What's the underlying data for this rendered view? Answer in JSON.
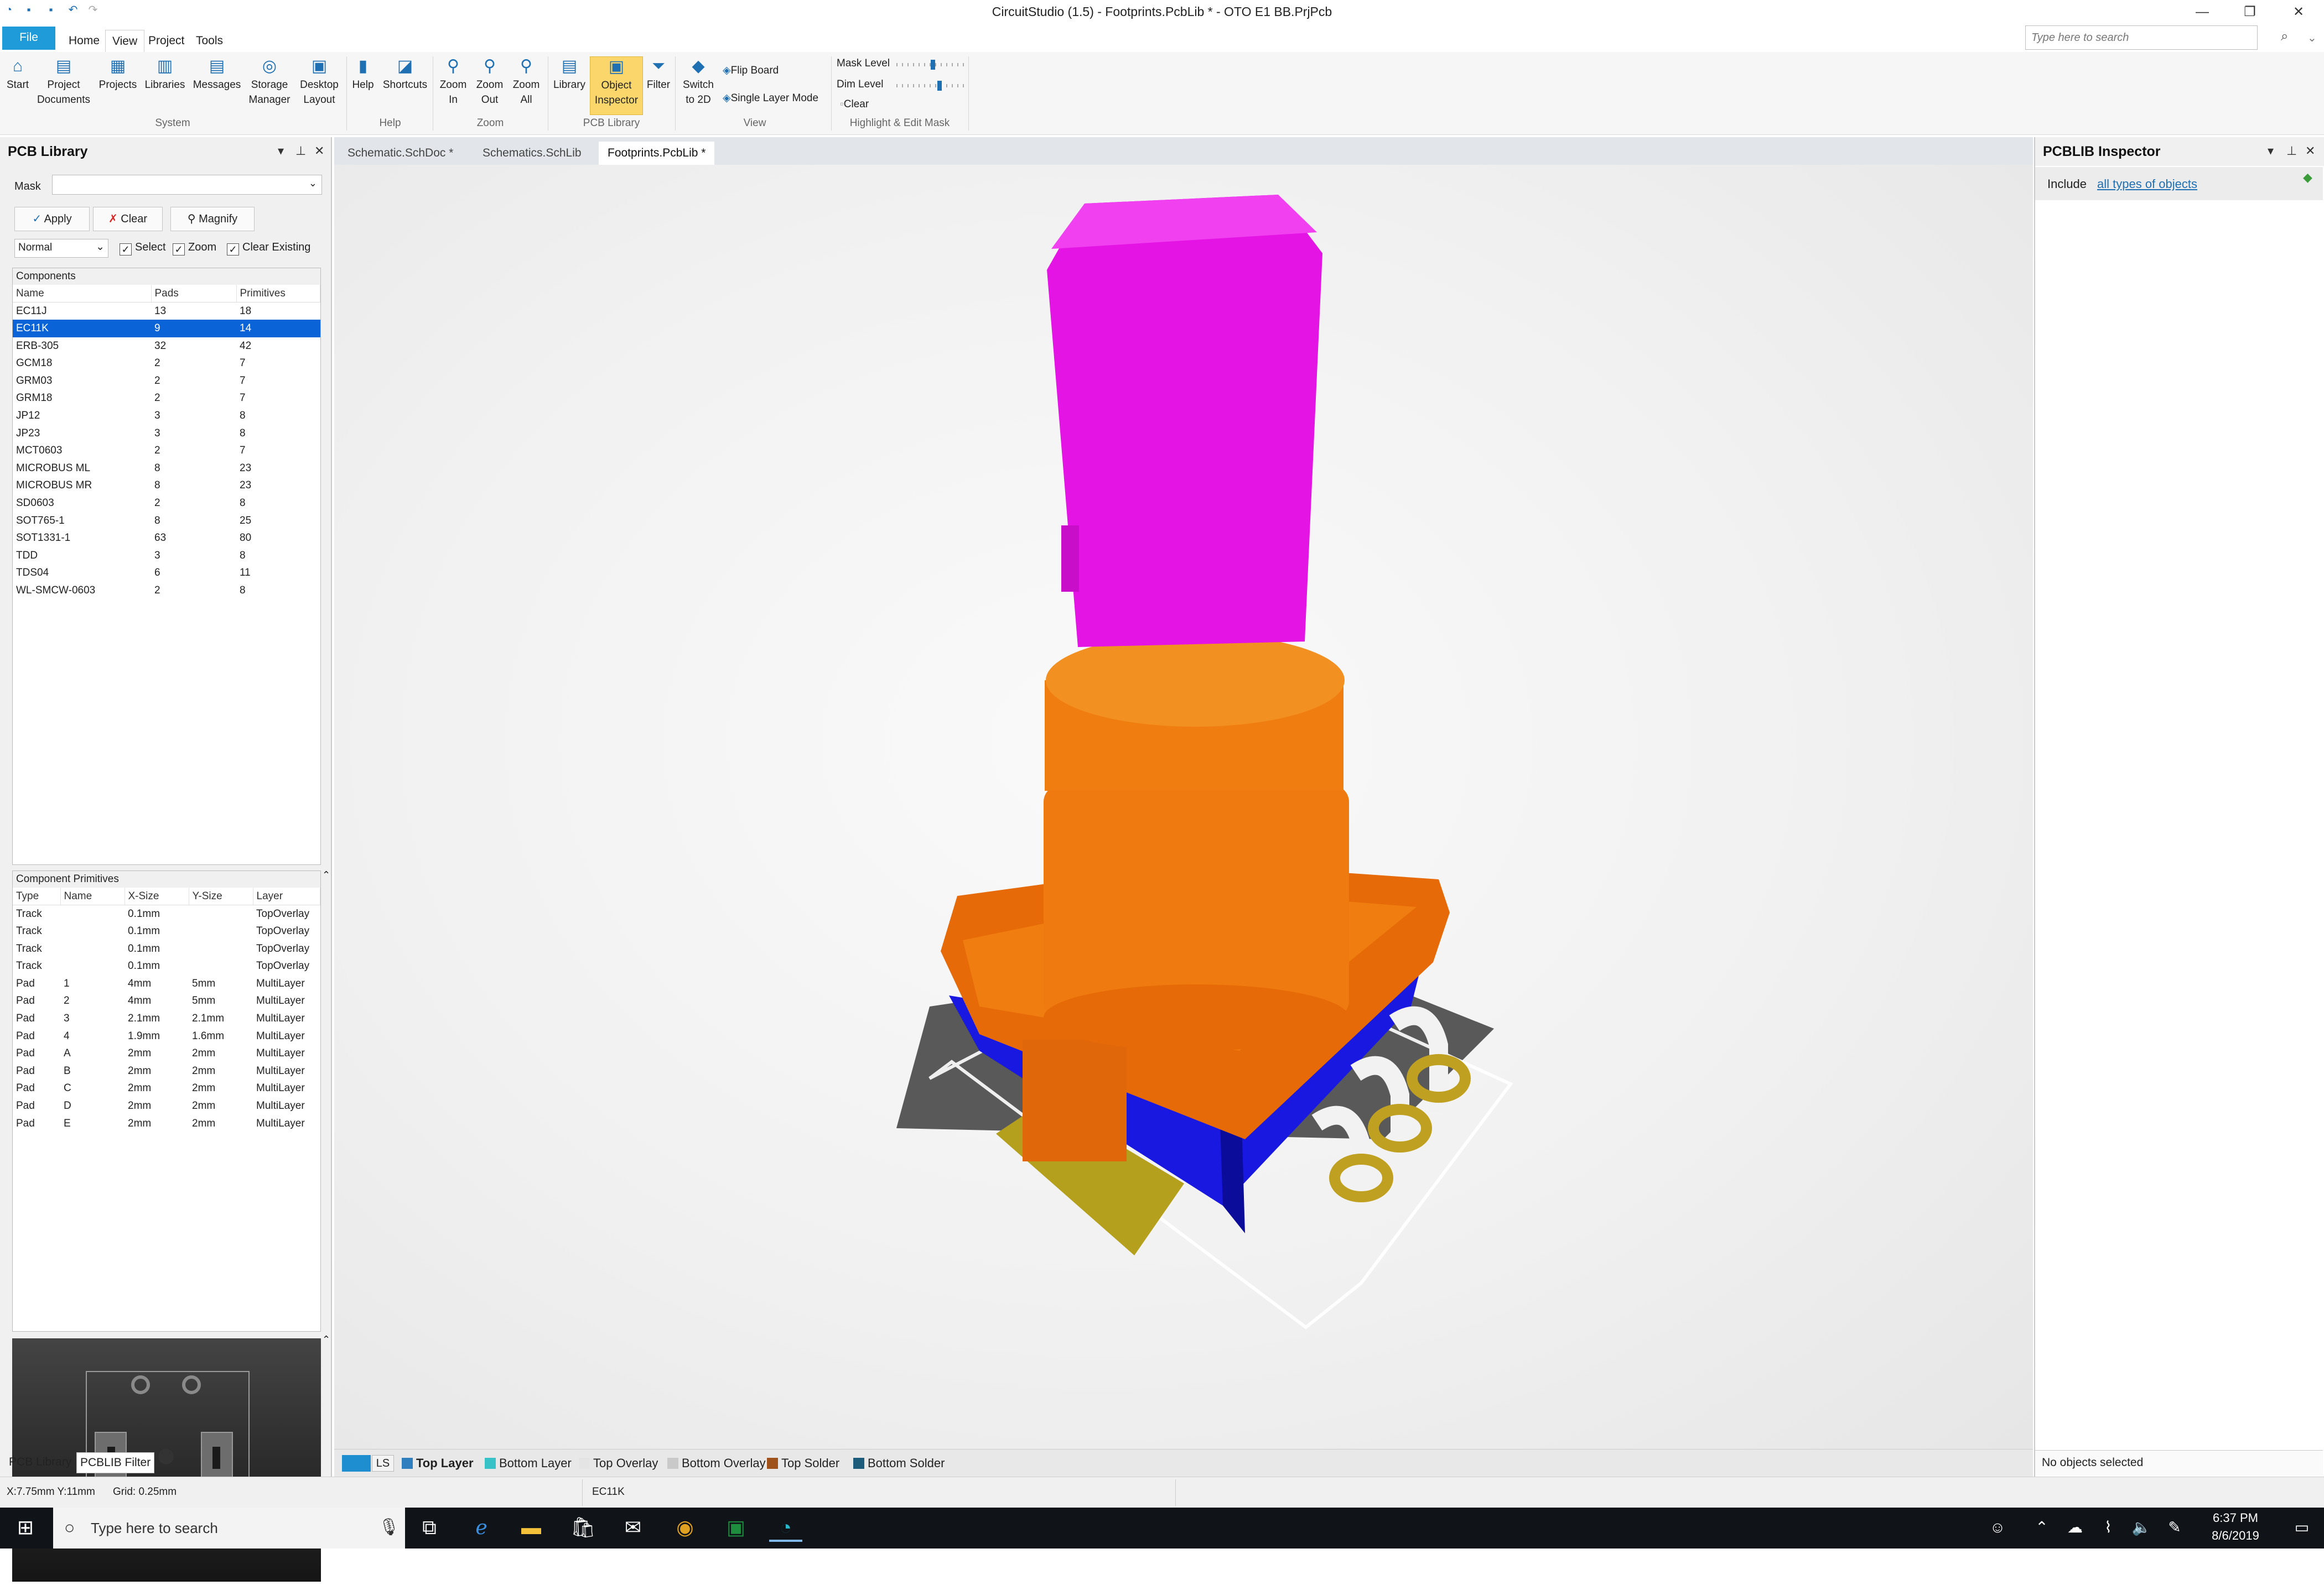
{
  "window": {
    "title": "CircuitStudio (1.5) - Footprints.PcbLib * - OTO E1 BB.PrjPcb"
  },
  "ribbon_tabs": [
    "File",
    "Home",
    "View",
    "Project",
    "Tools"
  ],
  "search": {
    "placeholder": "Type here to search"
  },
  "ribbon": {
    "buttons": {
      "start": "Start",
      "project_documents": "Project Documents",
      "projects": "Projects",
      "libraries": "Libraries",
      "messages": "Messages",
      "storage_manager": "Storage Manager",
      "desktop_layout": "Desktop Layout",
      "help": "Help",
      "shortcuts": "Shortcuts",
      "zoom_in": "Zoom In",
      "zoom_out": "Zoom Out",
      "zoom_all": "Zoom All",
      "library": "Library",
      "object_inspector": "Object Inspector",
      "filter": "Filter",
      "switch_2d": "Switch to 2D",
      "flip_board": "Flip Board",
      "single_layer_mode": "Single Layer Mode",
      "mask_level": "Mask Level",
      "dim_level": "Dim Level",
      "clear": "Clear"
    },
    "groups": {
      "system": "System",
      "help": "Help",
      "zoom": "Zoom",
      "pcb_library": "PCB Library",
      "view": "View",
      "highlight": "Highlight & Edit Mask"
    },
    "mask_level": 0.5,
    "dim_level": 0.6
  },
  "pcb_library": {
    "title": "PCB Library",
    "mask_label": "Mask",
    "mask_value": "",
    "apply": "Apply",
    "clear": "Clear",
    "magnify": "Magnify",
    "mode": "Normal",
    "select": "Select",
    "zoom": "Zoom",
    "clear_existing": "Clear Existing",
    "components_label": "Components",
    "columns": [
      "Name",
      "Pads",
      "Primitives"
    ],
    "components": [
      [
        "EC11J",
        "13",
        "18"
      ],
      [
        "EC11K",
        "9",
        "14"
      ],
      [
        "ERB-305",
        "32",
        "42"
      ],
      [
        "GCM18",
        "2",
        "7"
      ],
      [
        "GRM03",
        "2",
        "7"
      ],
      [
        "GRM18",
        "2",
        "7"
      ],
      [
        "JP12",
        "3",
        "8"
      ],
      [
        "JP23",
        "3",
        "8"
      ],
      [
        "MCT0603",
        "2",
        "7"
      ],
      [
        "MICROBUS ML",
        "8",
        "23"
      ],
      [
        "MICROBUS MR",
        "8",
        "23"
      ],
      [
        "SD0603",
        "2",
        "8"
      ],
      [
        "SOT765-1",
        "8",
        "25"
      ],
      [
        "SOT1331-1",
        "63",
        "80"
      ],
      [
        "TDD",
        "3",
        "8"
      ],
      [
        "TDS04",
        "6",
        "11"
      ],
      [
        "WL-SMCW-0603",
        "2",
        "8"
      ]
    ],
    "primitives_label": "Component Primitives",
    "prim_columns": [
      "Type",
      "Name",
      "X-Size",
      "Y-Size",
      "Layer"
    ],
    "primitives": [
      [
        "Track",
        "",
        "0.1mm",
        "",
        "TopOverlay"
      ],
      [
        "Track",
        "",
        "0.1mm",
        "",
        "TopOverlay"
      ],
      [
        "Track",
        "",
        "0.1mm",
        "",
        "TopOverlay"
      ],
      [
        "Track",
        "",
        "0.1mm",
        "",
        "TopOverlay"
      ],
      [
        "Pad",
        "1",
        "4mm",
        "5mm",
        "MultiLayer"
      ],
      [
        "Pad",
        "2",
        "4mm",
        "5mm",
        "MultiLayer"
      ],
      [
        "Pad",
        "3",
        "2.1mm",
        "2.1mm",
        "MultiLayer"
      ],
      [
        "Pad",
        "4",
        "1.9mm",
        "1.6mm",
        "MultiLayer"
      ],
      [
        "Pad",
        "A",
        "2mm",
        "2mm",
        "MultiLayer"
      ],
      [
        "Pad",
        "B",
        "2mm",
        "2mm",
        "MultiLayer"
      ],
      [
        "Pad",
        "C",
        "2mm",
        "2mm",
        "MultiLayer"
      ],
      [
        "Pad",
        "D",
        "2mm",
        "2mm",
        "MultiLayer"
      ],
      [
        "Pad",
        "E",
        "2mm",
        "2mm",
        "MultiLayer"
      ]
    ],
    "bottom_tabs": [
      "PCB Library",
      "PCBLIB Filter"
    ]
  },
  "doc_tabs": [
    "Schematic.SchDoc *",
    "Schematics.SchLib",
    "Footprints.PcbLib *"
  ],
  "layers": {
    "ls": "LS",
    "items": [
      {
        "label": "Top Layer",
        "color": "#2f7fbf"
      },
      {
        "label": "Bottom Layer",
        "color": "#36c2c6"
      },
      {
        "label": "Top Overlay",
        "color": "#e4e4e4"
      },
      {
        "label": "Bottom Overlay",
        "color": "#c9c9c9"
      },
      {
        "label": "Top Solder",
        "color": "#a0521d"
      },
      {
        "label": "Bottom Solder",
        "color": "#1a5c7a"
      }
    ]
  },
  "inspector": {
    "title": "PCBLIB Inspector",
    "include": "Include",
    "link": "all types of objects",
    "no_selection": "No objects selected"
  },
  "status": {
    "coords": "X:7.75mm Y:11mm",
    "grid": "Grid: 0.25mm",
    "component": "EC11K"
  },
  "taskbar": {
    "search": "Type here to search",
    "time": "6:37 PM",
    "date": "8/6/2019"
  }
}
